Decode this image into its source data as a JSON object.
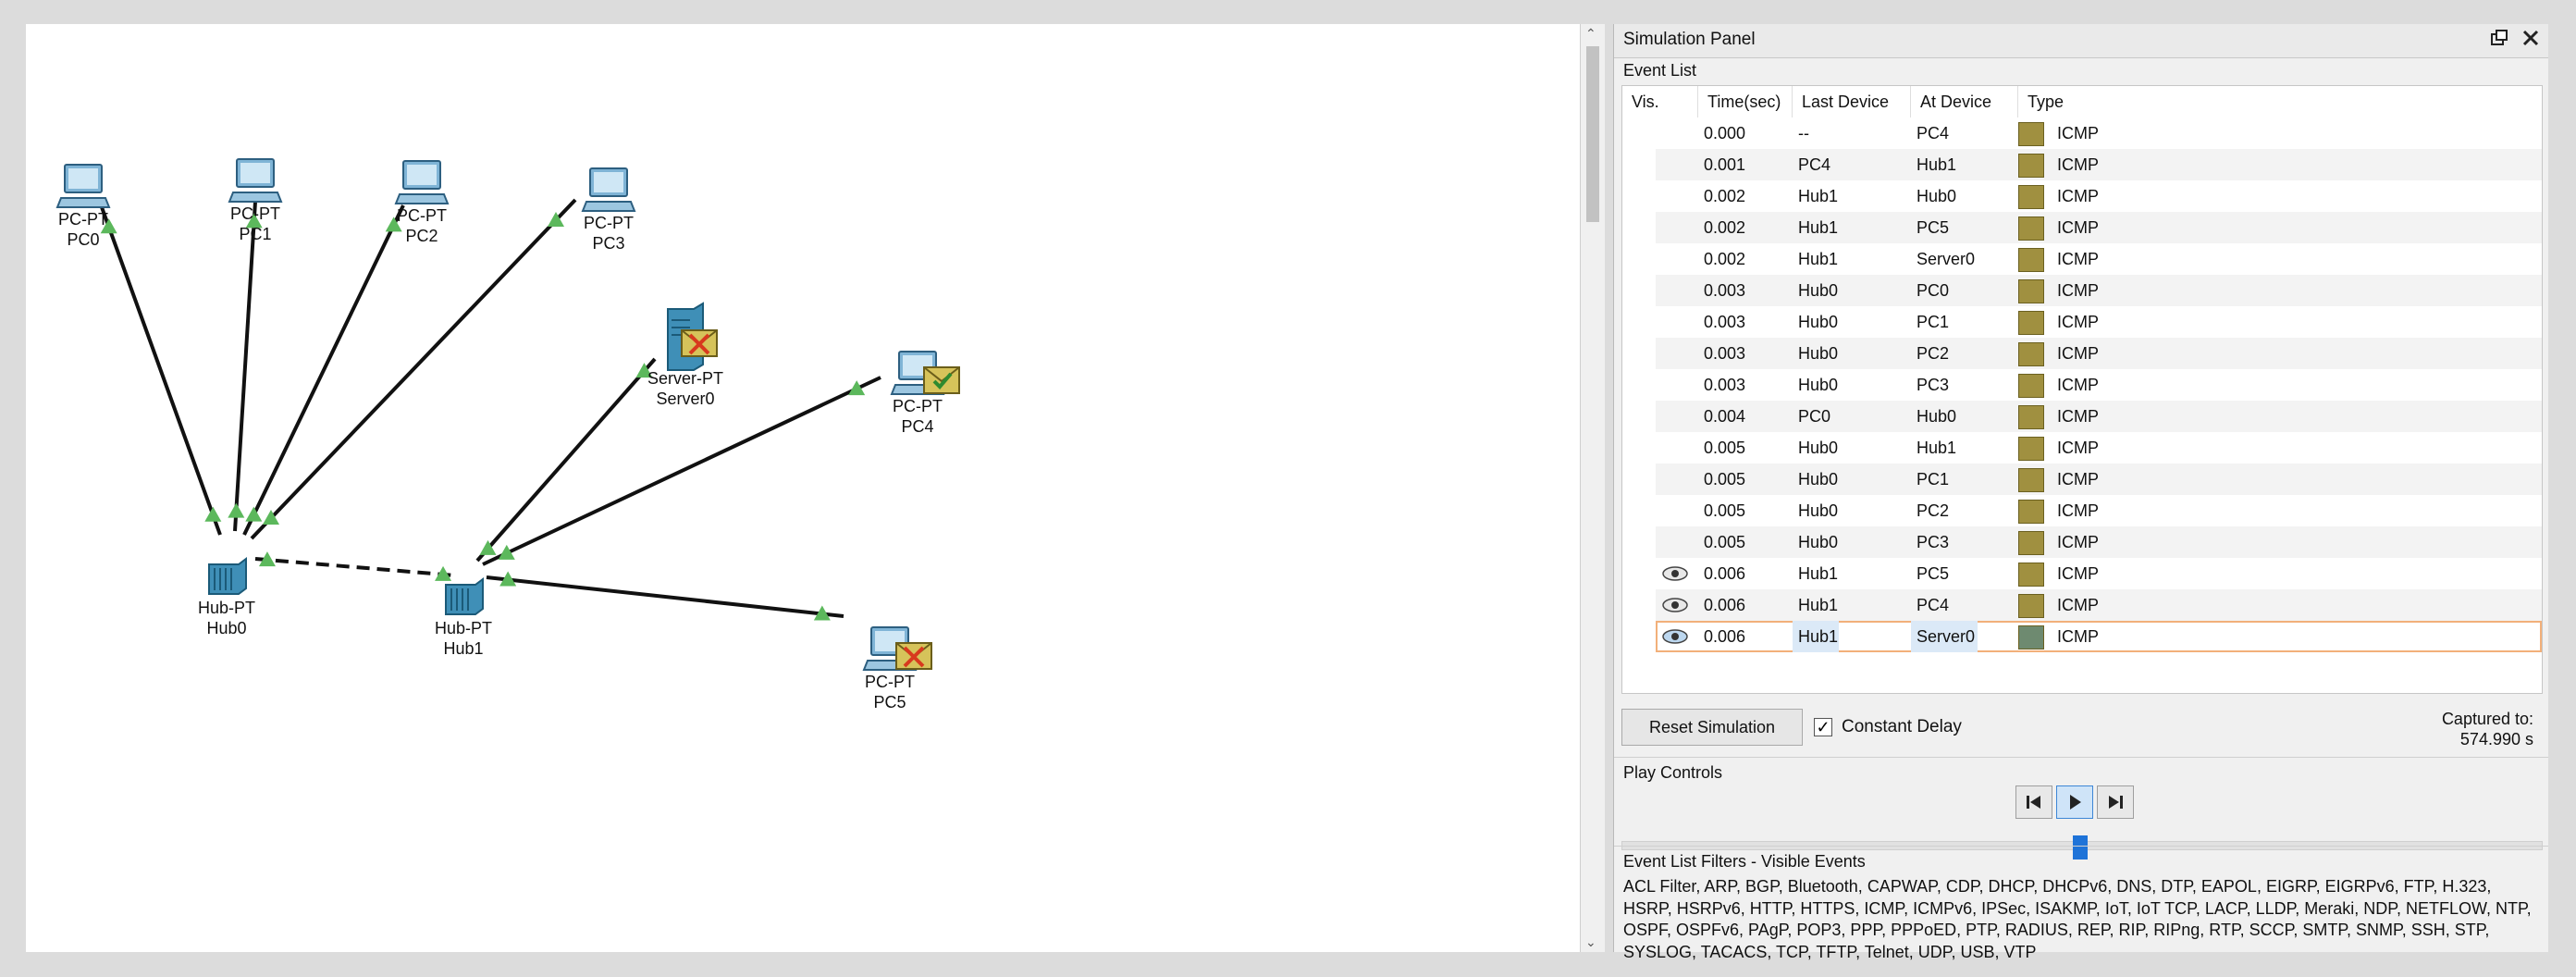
{
  "panel": {
    "title": "Simulation Panel",
    "event_list_label": "Event List",
    "columns": [
      "Vis.",
      "Time(sec)",
      "Last Device",
      "At Device",
      "Type"
    ],
    "events": [
      {
        "time": "0.000",
        "last": "--",
        "at": "PC4",
        "type": "ICMP",
        "vis": false
      },
      {
        "time": "0.001",
        "last": "PC4",
        "at": "Hub1",
        "type": "ICMP",
        "vis": false
      },
      {
        "time": "0.002",
        "last": "Hub1",
        "at": "Hub0",
        "type": "ICMP",
        "vis": false
      },
      {
        "time": "0.002",
        "last": "Hub1",
        "at": "PC5",
        "type": "ICMP",
        "vis": false
      },
      {
        "time": "0.002",
        "last": "Hub1",
        "at": "Server0",
        "type": "ICMP",
        "vis": false
      },
      {
        "time": "0.003",
        "last": "Hub0",
        "at": "PC0",
        "type": "ICMP",
        "vis": false
      },
      {
        "time": "0.003",
        "last": "Hub0",
        "at": "PC1",
        "type": "ICMP",
        "vis": false
      },
      {
        "time": "0.003",
        "last": "Hub0",
        "at": "PC2",
        "type": "ICMP",
        "vis": false
      },
      {
        "time": "0.003",
        "last": "Hub0",
        "at": "PC3",
        "type": "ICMP",
        "vis": false
      },
      {
        "time": "0.004",
        "last": "PC0",
        "at": "Hub0",
        "type": "ICMP",
        "vis": false
      },
      {
        "time": "0.005",
        "last": "Hub0",
        "at": "Hub1",
        "type": "ICMP",
        "vis": false
      },
      {
        "time": "0.005",
        "last": "Hub0",
        "at": "PC1",
        "type": "ICMP",
        "vis": false
      },
      {
        "time": "0.005",
        "last": "Hub0",
        "at": "PC2",
        "type": "ICMP",
        "vis": false
      },
      {
        "time": "0.005",
        "last": "Hub0",
        "at": "PC3",
        "type": "ICMP",
        "vis": false
      },
      {
        "time": "0.006",
        "last": "Hub1",
        "at": "PC5",
        "type": "ICMP",
        "vis": true
      },
      {
        "time": "0.006",
        "last": "Hub1",
        "at": "PC4",
        "type": "ICMP",
        "vis": true
      },
      {
        "time": "0.006",
        "last": "Hub1",
        "at": "Server0",
        "type": "ICMP",
        "vis": true,
        "selected": true
      }
    ],
    "reset_label": "Reset Simulation",
    "constant_delay_label": "Constant Delay",
    "constant_delay_checked": true,
    "captured_label": "Captured to:",
    "captured_value": "574.990 s",
    "play_controls_label": "Play Controls",
    "filters_label": "Event List Filters - Visible Events",
    "filters_text": "ACL Filter, ARP, BGP, Bluetooth, CAPWAP, CDP, DHCP, DHCPv6, DNS, DTP, EAPOL, EIGRP, EIGRPv6, FTP, H.323, HSRP, HSRPv6, HTTP, HTTPS, ICMP, ICMPv6, IPSec, ISAKMP, IoT, IoT TCP, LACP, LLDP, Meraki, NDP, NETFLOW, NTP, OSPF, OSPFv6, PAgP, POP3, PPP, PPPoED, PTP, RADIUS, REP, RIP, RIPng, RTP, SCCP, SMTP, SNMP, SSH, STP, SYSLOG, TACACS, TCP, TFTP, Telnet, UDP, USB, VTP"
  },
  "colors": {
    "icmp": "#a09040",
    "icmp_selected": "#6e8a70",
    "link_up": "#5cb85c",
    "accent": "#1e73d8"
  },
  "workspace": {
    "devices": [
      {
        "id": "PC0",
        "model": "PC-PT",
        "name": "PC0",
        "kind": "pc"
      },
      {
        "id": "PC1",
        "model": "PC-PT",
        "name": "PC1",
        "kind": "pc"
      },
      {
        "id": "PC2",
        "model": "PC-PT",
        "name": "PC2",
        "kind": "pc"
      },
      {
        "id": "PC3",
        "model": "PC-PT",
        "name": "PC3",
        "kind": "pc"
      },
      {
        "id": "Server0",
        "model": "Server-PT",
        "name": "Server0",
        "kind": "server",
        "envelope": "fail"
      },
      {
        "id": "PC4",
        "model": "PC-PT",
        "name": "PC4",
        "kind": "pc",
        "envelope": "ok"
      },
      {
        "id": "Hub0",
        "model": "Hub-PT",
        "name": "Hub0",
        "kind": "hub"
      },
      {
        "id": "Hub1",
        "model": "Hub-PT",
        "name": "Hub1",
        "kind": "hub"
      },
      {
        "id": "PC5",
        "model": "PC-PT",
        "name": "PC5",
        "kind": "pc",
        "envelope": "fail"
      }
    ],
    "links": [
      {
        "from": "PC0",
        "to": "Hub0",
        "style": "solid"
      },
      {
        "from": "PC1",
        "to": "Hub0",
        "style": "solid"
      },
      {
        "from": "PC2",
        "to": "Hub0",
        "style": "solid"
      },
      {
        "from": "PC3",
        "to": "Hub0",
        "style": "solid"
      },
      {
        "from": "Hub0",
        "to": "Hub1",
        "style": "dashed"
      },
      {
        "from": "Server0",
        "to": "Hub1",
        "style": "solid"
      },
      {
        "from": "PC4",
        "to": "Hub1",
        "style": "solid"
      },
      {
        "from": "PC5",
        "to": "Hub1",
        "style": "solid"
      }
    ]
  }
}
